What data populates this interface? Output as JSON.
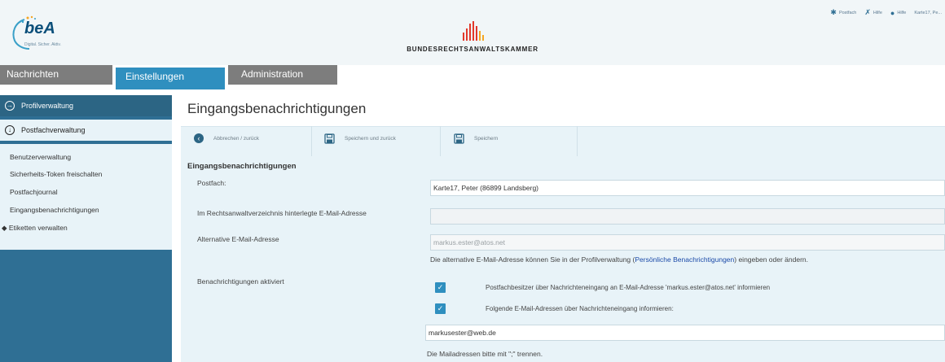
{
  "header": {
    "logo_text": "beA",
    "logo_sub": "Digital. Sicher. Aktiv.",
    "brand": "BUNDESRECHTSANWALTSKAMMER",
    "top_links": [
      {
        "icon": "gear-icon",
        "label": "Postfach"
      },
      {
        "icon": "wrench-icon",
        "label": "Hilfe"
      },
      {
        "icon": "question-icon",
        "label": "Hilfe"
      },
      {
        "icon": "user-icon",
        "label": "Karte17, Pe..."
      }
    ]
  },
  "tabs": [
    {
      "label": "Nachrichten"
    },
    {
      "label": "Einstellungen"
    },
    {
      "label": "Administration"
    }
  ],
  "sidebar": {
    "profilverwaltung": "Profilverwaltung",
    "postfachverwaltung": "Postfachverwaltung",
    "sub_items": [
      "Benutzerverwaltung",
      "Sicherheits-Token freischalten",
      "Postfachjournal",
      "Eingangsbenachrichtigungen"
    ],
    "etiketten": "Etiketten verwalten"
  },
  "main": {
    "title": "Eingangsbenachrichtigungen",
    "toolbar": {
      "back": "Abbrechen / zurück",
      "save_back": "Speichern und zurück",
      "save": "Speichern"
    },
    "form": {
      "heading": "Eingangsbenachrichtigungen",
      "postfach_label": "Postfach:",
      "postfach_value": "Karte17, Peter (86899 Landsberg)",
      "rav_label": "Im Rechtsanwaltverzeichnis hinterlegte E-Mail-Adresse",
      "rav_value": "",
      "alt_label": "Alternative E-Mail-Adresse",
      "alt_value": "markus.ester@atos.net",
      "alt_help_pre": "Die alternative E-Mail-Adresse können Sie in der Profilverwaltung (",
      "alt_help_link": "Persönliche Benachrichtigungen",
      "alt_help_post": ") eingeben oder ändern.",
      "notify_label": "Benachrichtigungen aktiviert",
      "cb1_label": "Postfachbesitzer über Nachrichteneingang an E-Mail-Adresse 'markus.ester@atos.net' informieren",
      "cb2_label": "Folgende E-Mail-Adressen über Nachrichteneingang informieren:",
      "emails_value": "markusester@web.de",
      "emails_help": "Die Mailadressen bitte mit \";\" trennen."
    }
  },
  "colors": {
    "accent": "#2f8fbf",
    "sidebar": "#2f6f94",
    "panel": "#e8f3f8",
    "tab_inactive": "#7d7d7d"
  }
}
